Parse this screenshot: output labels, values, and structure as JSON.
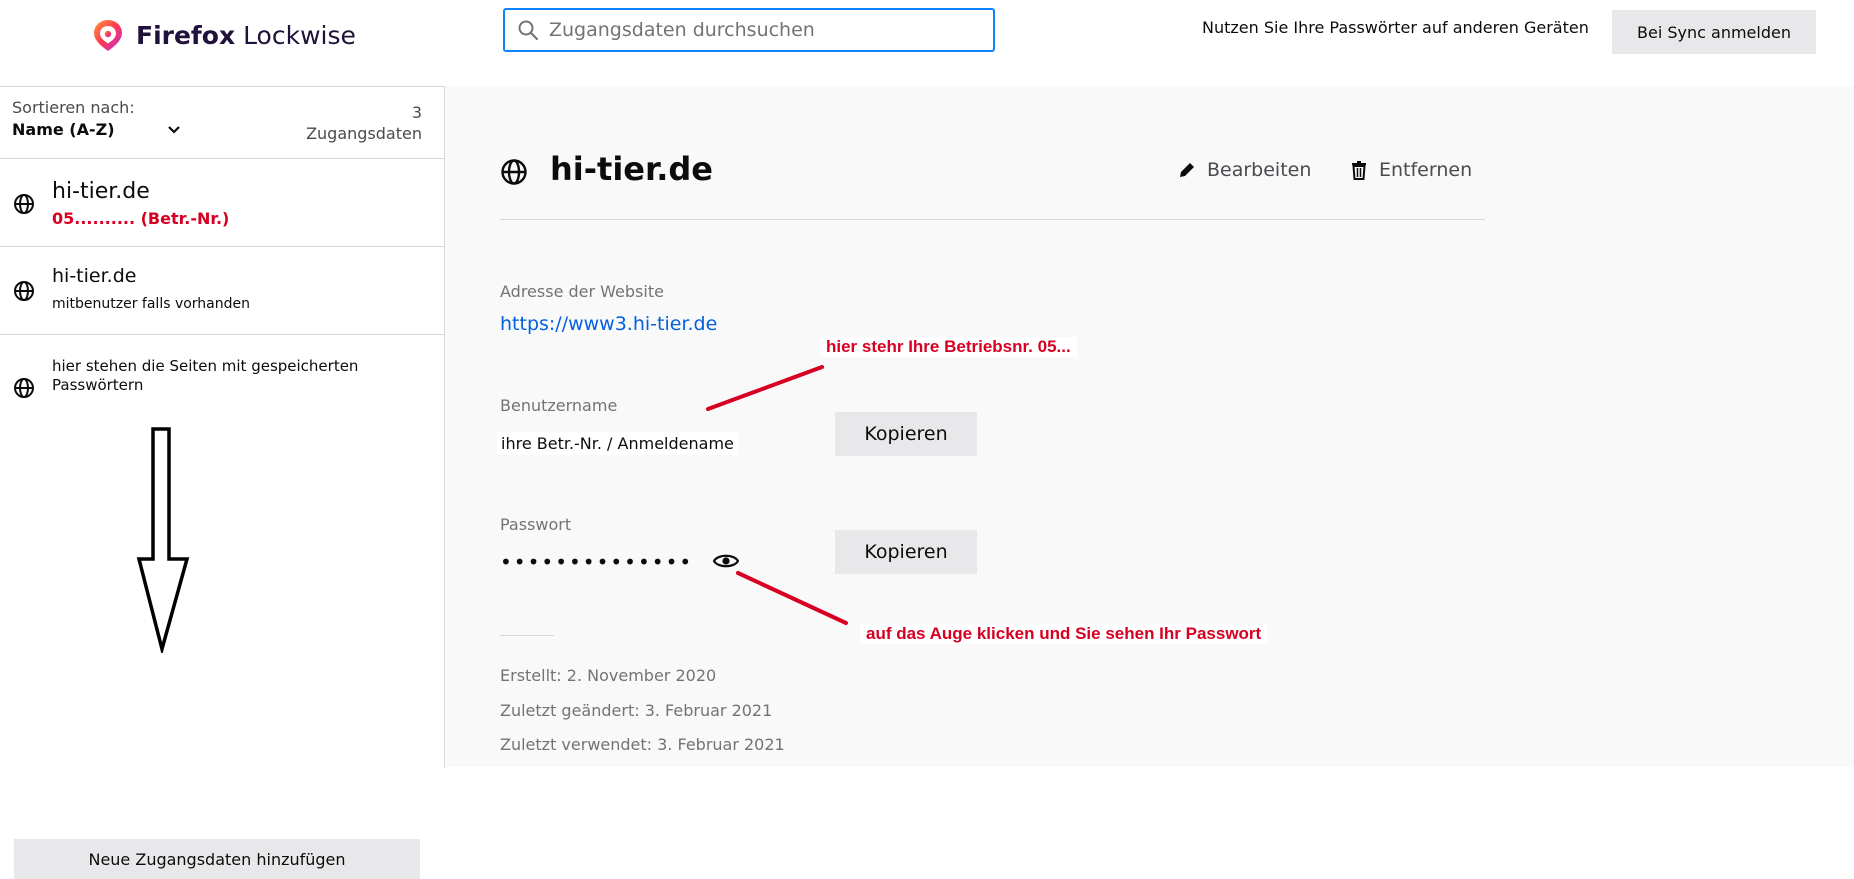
{
  "header": {
    "logo_brand": "Firefox",
    "logo_product": "Lockwise",
    "search_placeholder": "Zugangsdaten durchsuchen",
    "sync_hint": "Nutzen Sie Ihre Passwörter auf anderen Geräten",
    "sync_button": "Bei Sync anmelden"
  },
  "sidebar": {
    "sort_label": "Sortieren nach:",
    "sort_value": "Name (A-Z)",
    "count_number": "3",
    "count_label": "Zugangsdaten",
    "entries": [
      {
        "title": "hi-tier.de",
        "subtitle": "05.......... (Betr.-Nr.)",
        "icon": "globe-icon"
      },
      {
        "title": "hi-tier.de",
        "subtitle": "mitbenutzer falls vorhanden",
        "icon": "globe-icon"
      },
      {
        "title": "hier stehen die Seiten mit gespeicherten Passwörtern",
        "icon": "globe-icon"
      }
    ],
    "new_button": "Neue Zugangsdaten hinzufügen"
  },
  "detail": {
    "title": "hi-tier.de",
    "edit_label": "Bearbeiten",
    "remove_label": "Entfernen",
    "website_label": "Adresse der Website",
    "website_value": "https://www3.hi-tier.de",
    "username_label": "Benutzername",
    "username_value": "ihre Betr.-Nr. / Anmeldename",
    "copy_label": "Kopieren",
    "password_label": "Passwort",
    "password_value": "••••••••••••••",
    "created": "Erstellt: 2. November 2020",
    "modified": "Zuletzt geändert: 3. Februar 2021",
    "used": "Zuletzt verwendet: 3. Februar 2021"
  },
  "annotations": {
    "username_hint": "hier stehr Ihre Betriebsnr. 05...",
    "eye_hint": "auf das Auge klicken und Sie sehen Ihr Passwort",
    "annotation_color": "#d70022"
  },
  "colors": {
    "accent": "#0a84ff",
    "link": "#0060df",
    "panel_bg": "#f9f9fa",
    "button_bg": "#e8e8ea"
  }
}
